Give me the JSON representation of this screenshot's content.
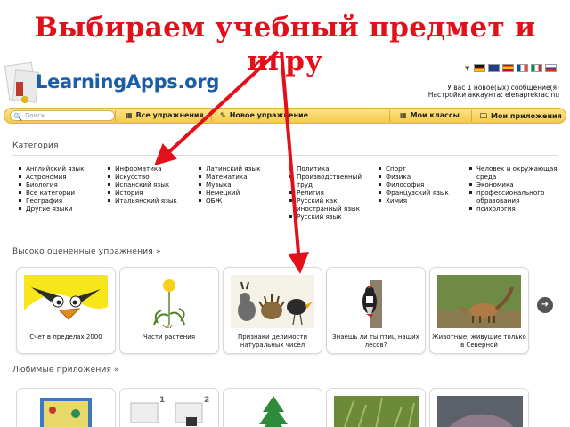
{
  "slide": {
    "title_line1": "Выбираем учебный предмет и",
    "title_line2": "игру",
    "arrow_color": "#e3101a"
  },
  "header": {
    "logo": "LearningApps.org",
    "user_line1": "У вас 1 новое(ых) сообщение(я)",
    "user_line2": "Настройки аккаунта: elenaprekrac.nu",
    "flags": [
      "de",
      "gb",
      "es",
      "fr",
      "it",
      "ru"
    ]
  },
  "nav": {
    "search_placeholder": "Поиск",
    "items": [
      {
        "icon": "grid-icon",
        "label": "Все упражнения"
      },
      {
        "icon": "pencil-icon",
        "label": "Новое упражнение"
      },
      {
        "icon": "grid-icon",
        "label": "Мои классы"
      },
      {
        "icon": "folder-icon",
        "label": "Мои приложения"
      }
    ]
  },
  "categories": {
    "heading": "Категория",
    "columns": [
      [
        "Английский язык",
        "Астрономия",
        "Биология",
        "Все категории",
        "География",
        "Другие языки"
      ],
      [
        "Информатика",
        "Искусство",
        "Испанский язык",
        "История",
        "Итальянский язык"
      ],
      [
        "Латинский язык",
        "Математика",
        "Музыка",
        "Немецкий",
        "ОБЖ"
      ],
      [
        "Политика",
        "Производственный труд",
        "Религия",
        "Русский как иностранный язык",
        "Русский язык"
      ],
      [
        "Спорт",
        "Физика",
        "Философия",
        "Французский язык",
        "Химия"
      ],
      [
        "Человек и окружающая среда",
        "Экономика",
        "профессионального образования",
        "психология"
      ]
    ]
  },
  "top_rated": {
    "heading": "Высоко оцененные упражнения »",
    "tiles": [
      {
        "caption": "Счёт в пределах 2000"
      },
      {
        "caption": "Части растения"
      },
      {
        "caption": "Признаки делимости натуральных чисел"
      },
      {
        "caption": "Знаешь ли ты птиц наших лесов?"
      },
      {
        "caption": "Животные, живущие только в Северной"
      }
    ]
  },
  "favorites": {
    "heading": "Любимые приложения »",
    "numbers": [
      "1",
      "2"
    ]
  }
}
